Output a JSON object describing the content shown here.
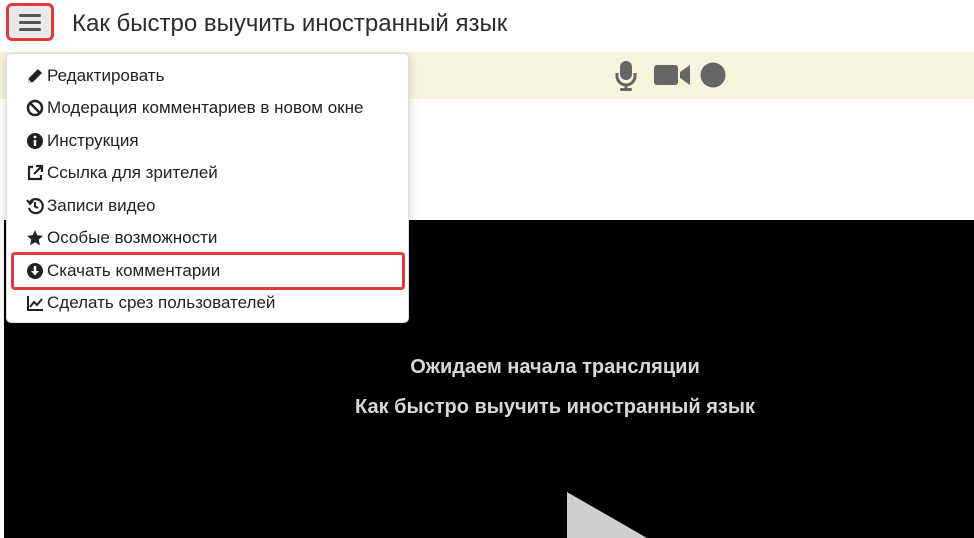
{
  "header": {
    "title": "Как быстро выучить иностранный язык",
    "menu_icon": "hamburger-icon"
  },
  "toolbar": {
    "icons": [
      "microphone-icon",
      "video-camera-icon",
      "record-circle-icon"
    ],
    "strip_color": "#f6f4dd"
  },
  "menu": {
    "items": [
      {
        "icon": "pencil-icon",
        "label": "Редактировать"
      },
      {
        "icon": "ban-icon",
        "label": "Модерация комментариев в новом окне"
      },
      {
        "icon": "info-circle-icon",
        "label": "Инструкция"
      },
      {
        "icon": "external-link-icon",
        "label": "Ссылка для зрителей"
      },
      {
        "icon": "history-icon",
        "label": "Записи видео"
      },
      {
        "icon": "star-icon",
        "label": "Особые возможности"
      },
      {
        "icon": "download-circle-icon",
        "label": "Скачать комментарии",
        "highlighted": true
      },
      {
        "icon": "line-chart-icon",
        "label": "Сделать срез пользователей"
      }
    ]
  },
  "video": {
    "line1": "Ожидаем начала трансляции",
    "line2": "Как быстро выучить иностранный язык",
    "play_icon": "play-icon"
  },
  "colors": {
    "highlight": "#e0393b",
    "video_background": "#000000",
    "icon_gray": "#666666"
  }
}
